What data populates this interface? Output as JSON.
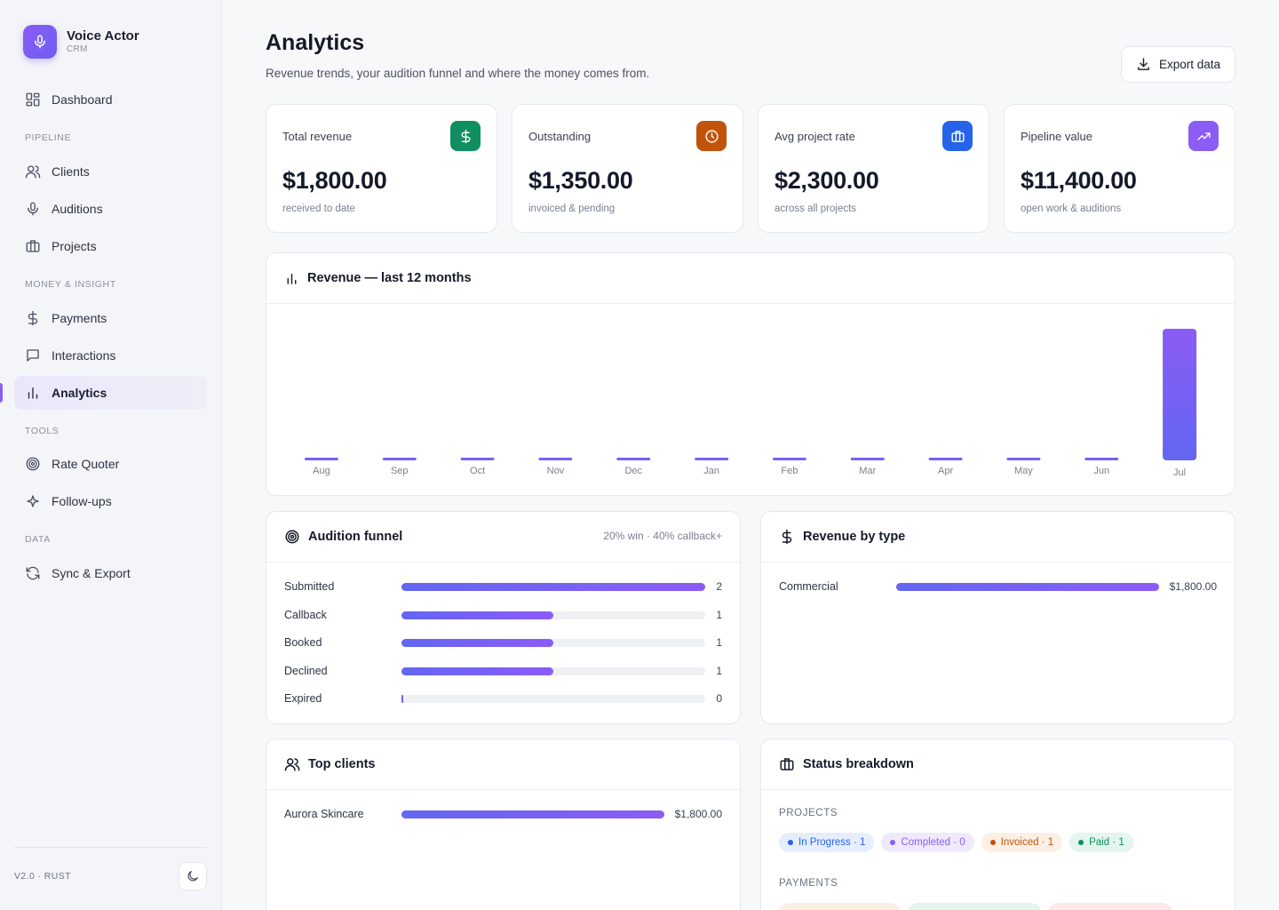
{
  "brand": {
    "title": "Voice Actor",
    "subtitle": "CRM"
  },
  "sidebar": {
    "sections": [
      "PIPELINE",
      "MONEY & INSIGHT",
      "TOOLS",
      "DATA"
    ],
    "items": [
      {
        "label": "Dashboard",
        "icon": "grid-icon"
      },
      {
        "label": "Clients",
        "icon": "users-icon"
      },
      {
        "label": "Auditions",
        "icon": "mic-icon"
      },
      {
        "label": "Projects",
        "icon": "briefcase-icon"
      },
      {
        "label": "Payments",
        "icon": "dollar-icon"
      },
      {
        "label": "Interactions",
        "icon": "message-icon"
      },
      {
        "label": "Analytics",
        "icon": "bar-chart-icon",
        "active": true
      },
      {
        "label": "Rate Quoter",
        "icon": "target-icon"
      },
      {
        "label": "Follow-ups",
        "icon": "sparkle-icon"
      },
      {
        "label": "Sync & Export",
        "icon": "refresh-icon"
      }
    ],
    "version": "V2.0 · RUST"
  },
  "header": {
    "title": "Analytics",
    "subtitle": "Revenue trends, your audition funnel and where the money comes from.",
    "export_label": "Export data"
  },
  "kpis": [
    {
      "label": "Total revenue",
      "value": "$1,800.00",
      "note": "received to date",
      "icon": "dollar-icon",
      "color": "#0f8f5f"
    },
    {
      "label": "Outstanding",
      "value": "$1,350.00",
      "note": "invoiced & pending",
      "icon": "clock-icon",
      "color": "#c2530a"
    },
    {
      "label": "Avg project rate",
      "value": "$2,300.00",
      "note": "across all projects",
      "icon": "briefcase-icon",
      "color": "#2563eb"
    },
    {
      "label": "Pipeline value",
      "value": "$11,400.00",
      "note": "open work & auditions",
      "icon": "trend-up-icon",
      "color": "#8b5cf6"
    }
  ],
  "revenue_chart": {
    "title": "Revenue — last 12 months"
  },
  "chart_data": {
    "type": "bar",
    "categories": [
      "Aug",
      "Sep",
      "Oct",
      "Nov",
      "Dec",
      "Jan",
      "Feb",
      "Mar",
      "Apr",
      "May",
      "Jun",
      "Jul"
    ],
    "values": [
      0,
      0,
      0,
      0,
      0,
      0,
      0,
      0,
      0,
      0,
      0,
      1800
    ],
    "xlabel": "",
    "ylabel": "",
    "ylim": [
      0,
      1800
    ],
    "grid": false
  },
  "funnel": {
    "title": "Audition funnel",
    "meta": "20% win · 40% callback+",
    "max": 2,
    "rows": [
      {
        "label": "Submitted",
        "value": 2,
        "display": "2"
      },
      {
        "label": "Callback",
        "value": 1,
        "display": "1"
      },
      {
        "label": "Booked",
        "value": 1,
        "display": "1"
      },
      {
        "label": "Declined",
        "value": 1,
        "display": "1"
      },
      {
        "label": "Expired",
        "value": 0,
        "display": "0"
      }
    ]
  },
  "revenue_by_type": {
    "title": "Revenue by type",
    "max": 1800,
    "rows": [
      {
        "label": "Commercial",
        "value": 1800,
        "display": "$1,800.00"
      }
    ]
  },
  "top_clients": {
    "title": "Top clients",
    "max": 1800,
    "rows": [
      {
        "label": "Aurora Skincare",
        "value": 1800,
        "display": "$1,800.00"
      }
    ]
  },
  "status_breakdown": {
    "title": "Status breakdown",
    "projects_label": "PROJECTS",
    "projects": [
      {
        "label": "In Progress · 1",
        "color": "#2563eb",
        "bg": "#e6edfd"
      },
      {
        "label": "Completed · 0",
        "color": "#8b5cf6",
        "bg": "#efe9fd"
      },
      {
        "label": "Invoiced · 1",
        "color": "#c2530a",
        "bg": "#fcefe4"
      },
      {
        "label": "Paid · 1",
        "color": "#0f8f5f",
        "bg": "#e3f5ec"
      }
    ],
    "payments_label": "PAYMENTS"
  }
}
